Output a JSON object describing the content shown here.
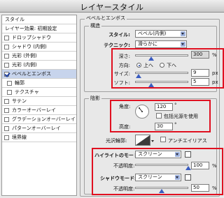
{
  "window": {
    "title": "レイヤースタイル"
  },
  "styles_list": {
    "items": [
      {
        "label": "スタイル",
        "type": "header"
      },
      {
        "label": "レイヤー効果: 初期設定",
        "type": "header"
      },
      {
        "label": "ドロップシャドウ",
        "checked": false
      },
      {
        "label": "シャドウ (内側)",
        "checked": false
      },
      {
        "label": "光彩 (外側)",
        "checked": false
      },
      {
        "label": "光彩 (内側)",
        "checked": false
      },
      {
        "label": "ベベルとエンボス",
        "checked": true,
        "selected": true
      },
      {
        "label": "輪郭",
        "checked": false,
        "sub": true
      },
      {
        "label": "テクスチャ",
        "checked": false,
        "sub": true
      },
      {
        "label": "サテン",
        "checked": false
      },
      {
        "label": "カラーオーバーレイ",
        "checked": false
      },
      {
        "label": "グラデーションオーバーレイ",
        "checked": false
      },
      {
        "label": "パターンオーバーレイ",
        "checked": false
      },
      {
        "label": "境界線",
        "checked": false
      }
    ]
  },
  "bevel": {
    "group_title": "ベベルとエンボス",
    "structure": {
      "title": "構造",
      "style_label": "スタイル:",
      "style_value": "ベベル(内側)",
      "technique_label": "テクニック:",
      "technique_value": "滑らかに",
      "depth_label": "深さ:",
      "depth_value": "300",
      "depth_unit": "%",
      "depth_level": 0.3,
      "direction_label": "方向:",
      "direction_up": "上へ",
      "direction_down": "下へ",
      "direction_selected": "up",
      "size_label": "サイズ:",
      "size_value": "9",
      "size_unit": "px",
      "size_level": 0.06,
      "soften_label": "ソフト:",
      "soften_value": "5",
      "soften_unit": "px",
      "soften_level": 0.3
    },
    "shading": {
      "title": "陰影",
      "angle_label": "角度:",
      "angle_value": "120",
      "angle_unit": "°",
      "global_light_label": "包括光源を使用",
      "global_light_checked": false,
      "altitude_label": "高度:",
      "altitude_value": "30",
      "altitude_unit": "°",
      "gloss_label": "光沢輪郭:",
      "antialias_label": "アンチエイリアス",
      "antialias_checked": false,
      "highlight_mode_label": "ハイライトのモード:",
      "highlight_mode_value": "スクリーン",
      "highlight_opacity_label": "不透明度:",
      "highlight_opacity_value": "100",
      "highlight_opacity_unit": "%",
      "shadow_mode_label": "シャドウモード:",
      "shadow_mode_value": "スクリーン",
      "shadow_opacity_label": "不透明度:",
      "shadow_opacity_value": "50",
      "shadow_opacity_unit": "%"
    }
  },
  "colors": {
    "highlight_box": "#e01020",
    "selection": "#c7d4ec",
    "slider_thumb": "#3a5cc0"
  }
}
